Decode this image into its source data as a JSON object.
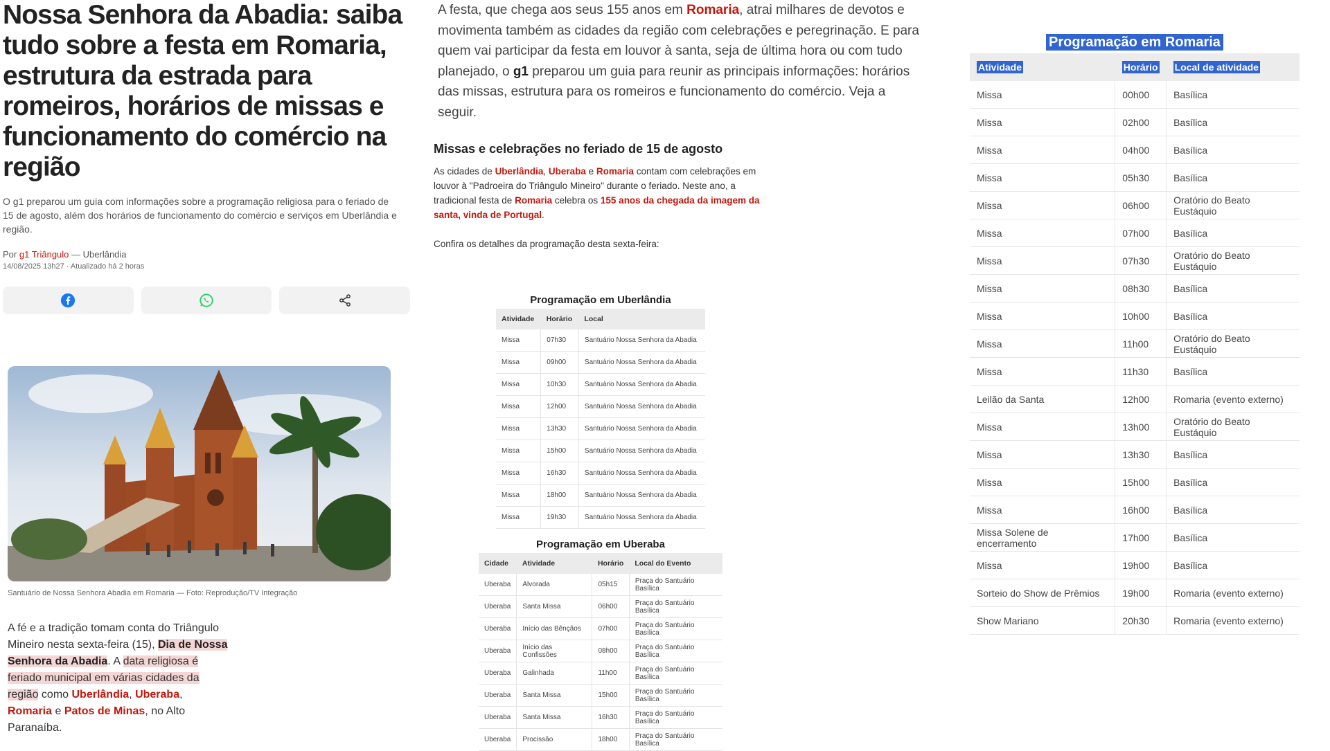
{
  "article": {
    "headline": "Nossa Senhora da Abadia: saiba tudo sobre a festa em Romaria, estrutura da estrada para romeiros, horários de missas e funcionamento do comércio na região",
    "subtitle": "O g1 preparou um guia com informações sobre a programação religiosa para o feriado de 15 de agosto, além dos horários de funcionamento do comércio e serviços em Uberlândia e região.",
    "byline_prefix": "Por",
    "author": "g1 Triângulo",
    "location": "— Uberlândia",
    "dateline": "14/08/2025 13h27 · Atualizado há 2 horas",
    "photo_caption": "Santuário de Nossa Senhora Abadia em Romaria — Foto: Reprodução/TV Integração",
    "lead": {
      "p1": "A fé e a tradição tomam conta do Triângulo Mineiro nesta sexta-feira (15), ",
      "h1": "Dia de Nossa Senhora da Abadia",
      "p2": ". A ",
      "h2": "data religiosa é feriado municipal em várias cidades da região",
      "p3": " como ",
      "c1": "Uberlândia",
      "p4": ", ",
      "c2": "Uberaba",
      "p5": ", ",
      "c3": "Romaria",
      "p6": " e ",
      "c4": "Patos de Minas",
      "p7": ", no Alto Paranaíba."
    },
    "intro": {
      "t1": "A festa, que chega aos seus 155 anos em ",
      "l1": "Romaria",
      "t2": ", atrai milhares de devotos e movimenta também as cidades da região com celebrações e peregrinação. E para quem vai participar da festa em louvor à santa, seja de última hora ou com tudo planejado, o ",
      "b1": "g1",
      "t3": " preparou um guia para reunir as principais informações: horários das missas, estrutura para os romeiros e funcionamento do comércio. Veja a seguir."
    },
    "section_heading": "Missas e celebrações no feriado de 15 de agosto",
    "section": {
      "t1": "As cidades de ",
      "l1": "Uberlândia",
      "t2": ", ",
      "l2": "Uberaba",
      "t3": " e ",
      "l3": "Romaria",
      "t4": " contam com celebrações em louvor à \"Padroeira do Triângulo Mineiro\" durante o feriado. Neste ano, a tradicional festa de ",
      "l4": "Romaria",
      "t5": " celebra os ",
      "l5": "155 anos da chegada da imagem da santa, vinda de Portugal",
      "t6": "."
    },
    "confira": "Confira os detalhes da programação desta sexta-feira:"
  },
  "uberlandia": {
    "title": "Programação em Uberlândia",
    "headers": [
      "Atividade",
      "Horário",
      "Local"
    ],
    "rows": [
      [
        "Missa",
        "07h30",
        "Santuário Nossa Senhora da Abadia"
      ],
      [
        "Missa",
        "09h00",
        "Santuário Nossa Senhora da Abadia"
      ],
      [
        "Missa",
        "10h30",
        "Santuário Nossa Senhora da Abadia"
      ],
      [
        "Missa",
        "12h00",
        "Santuário Nossa Senhora da Abadia"
      ],
      [
        "Missa",
        "13h30",
        "Santuário Nossa Senhora da Abadia"
      ],
      [
        "Missa",
        "15h00",
        "Santuário Nossa Senhora da Abadia"
      ],
      [
        "Missa",
        "16h30",
        "Santuário Nossa Senhora da Abadia"
      ],
      [
        "Missa",
        "18h00",
        "Santuário Nossa Senhora da Abadia"
      ],
      [
        "Missa",
        "19h30",
        "Santuário Nossa Senhora da Abadia"
      ]
    ]
  },
  "uberaba": {
    "title": "Programação em Uberaba",
    "headers": [
      "Cidade",
      "Atividade",
      "Horário",
      "Local do Evento"
    ],
    "rows": [
      [
        "Uberaba",
        "Alvorada",
        "05h15",
        "Praça do Santuário Basílica"
      ],
      [
        "Uberaba",
        "Santa Missa",
        "06h00",
        "Praça do Santuário Basílica"
      ],
      [
        "Uberaba",
        "Início das Bênçãos",
        "07h00",
        "Praça do Santuário Basílica"
      ],
      [
        "Uberaba",
        "Início das Confissões",
        "08h00",
        "Praça do Santuário Basílica"
      ],
      [
        "Uberaba",
        "Galinhada",
        "11h00",
        "Praça do Santuário Basílica"
      ],
      [
        "Uberaba",
        "Santa Missa",
        "15h00",
        "Praça do Santuário Basílica"
      ],
      [
        "Uberaba",
        "Santa Missa",
        "16h30",
        "Praça do Santuário Basílica"
      ],
      [
        "Uberaba",
        "Procissão",
        "18h00",
        "Praça do Santuário Basílica"
      ]
    ]
  },
  "romaria": {
    "title": "Programação em Romaria",
    "headers": [
      "Atividade",
      "Horário",
      "Local de atividade"
    ],
    "rows": [
      [
        "Missa",
        "00h00",
        "Basílica"
      ],
      [
        "Missa",
        "02h00",
        "Basílica"
      ],
      [
        "Missa",
        "04h00",
        "Basílica"
      ],
      [
        "Missa",
        "05h30",
        "Basílica"
      ],
      [
        "Missa",
        "06h00",
        "Oratório do Beato Eustáquio"
      ],
      [
        "Missa",
        "07h00",
        "Basílica"
      ],
      [
        "Missa",
        "07h30",
        "Oratório do Beato Eustáquio"
      ],
      [
        "Missa",
        "08h30",
        "Basílica"
      ],
      [
        "Missa",
        "10h00",
        "Basílica"
      ],
      [
        "Missa",
        "11h00",
        "Oratório do Beato Eustáquio"
      ],
      [
        "Missa",
        "11h30",
        "Basílica"
      ],
      [
        "Leilão da Santa",
        "12h00",
        "Romaria (evento externo)"
      ],
      [
        "Missa",
        "13h00",
        "Oratório do Beato Eustáquio"
      ],
      [
        "Missa",
        "13h30",
        "Basílica"
      ],
      [
        "Missa",
        "15h00",
        "Basílica"
      ],
      [
        "Missa",
        "16h00",
        "Basílica"
      ],
      [
        "Missa Solene de encerramento",
        "17h00",
        "Basílica"
      ],
      [
        "Missa",
        "19h00",
        "Basílica"
      ],
      [
        "Sorteio do Show de Prêmios",
        "19h00",
        "Romaria (evento externo)"
      ],
      [
        "Show Mariano",
        "20h30",
        "Romaria (evento externo)"
      ]
    ]
  },
  "share": {
    "icons": [
      "facebook-icon",
      "whatsapp-icon",
      "share-icon"
    ]
  },
  "colors": {
    "link_red": "#c4170c",
    "highlight_blue": "#2f64d1",
    "highlight_pink": "#f5d6d6"
  }
}
